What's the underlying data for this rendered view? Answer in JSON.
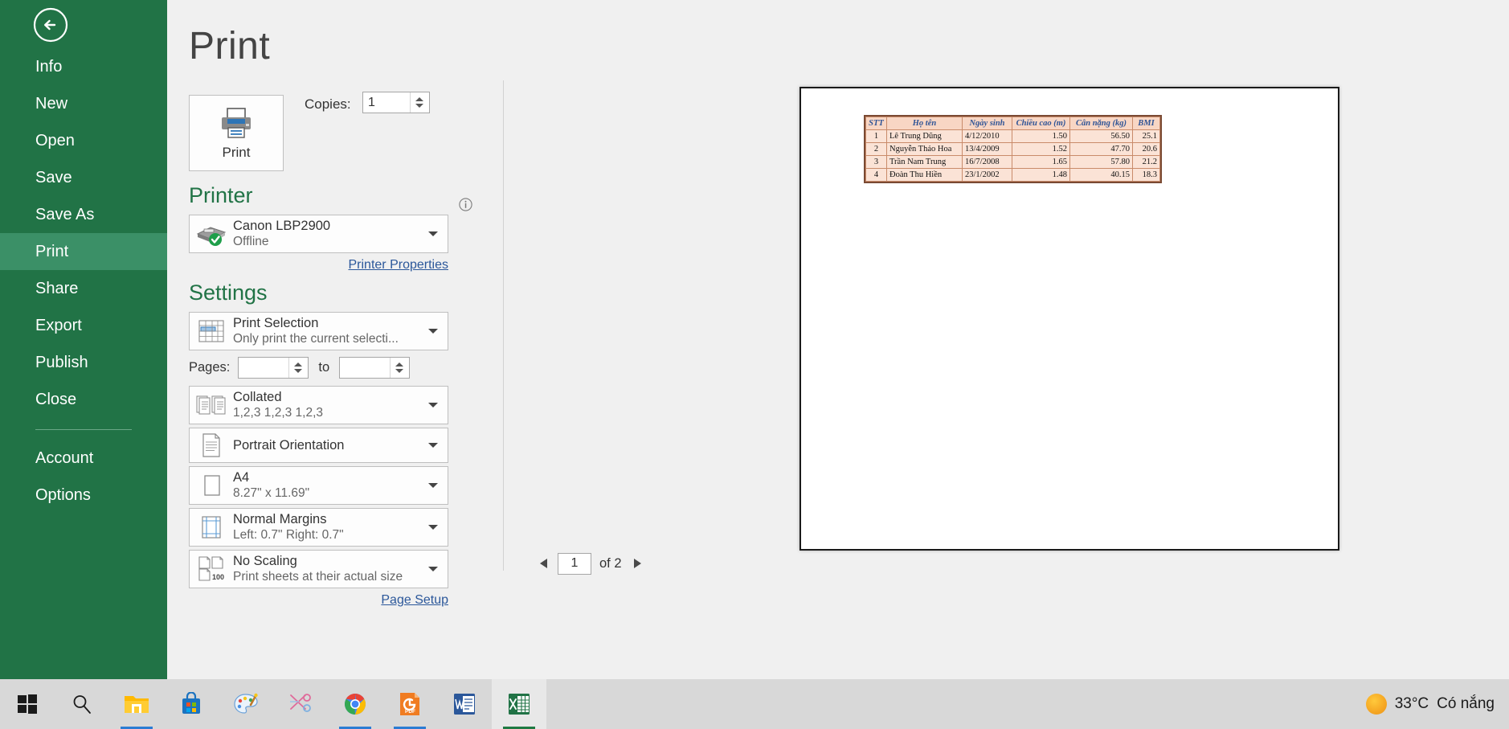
{
  "window": {
    "app": "Excel",
    "back_button": "back-arrow"
  },
  "sidebar": {
    "items": [
      {
        "label": "Info",
        "active": false
      },
      {
        "label": "New",
        "active": false
      },
      {
        "label": "Open",
        "active": false
      },
      {
        "label": "Save",
        "active": false
      },
      {
        "label": "Save As",
        "active": false
      },
      {
        "label": "Print",
        "active": true
      },
      {
        "label": "Share",
        "active": false
      },
      {
        "label": "Export",
        "active": false
      },
      {
        "label": "Publish",
        "active": false
      },
      {
        "label": "Close",
        "active": false
      }
    ],
    "footer_items": [
      {
        "label": "Account"
      },
      {
        "label": "Options"
      }
    ],
    "accent_color": "#217346",
    "active_color": "#3b9067"
  },
  "main": {
    "title": "Print",
    "print_button_label": "Print",
    "copies_label": "Copies:",
    "copies_value": "1",
    "printer_section_title": "Printer",
    "printer": {
      "name": "Canon LBP2900",
      "status": "Offline"
    },
    "printer_properties_link": "Printer Properties",
    "settings_section_title": "Settings",
    "settings": [
      {
        "icon": "print-selection-icon",
        "title": "Print Selection",
        "subtitle": "Only print the current selecti..."
      },
      {
        "icon": "collated-icon",
        "title": "Collated",
        "subtitle": "1,2,3   1,2,3   1,2,3"
      },
      {
        "icon": "portrait-icon",
        "title": "Portrait Orientation",
        "subtitle": ""
      },
      {
        "icon": "paper-size-icon",
        "title": "A4",
        "subtitle": "8.27\" x 11.69\""
      },
      {
        "icon": "margins-icon",
        "title": "Normal Margins",
        "subtitle": "Left:  0.7\"    Right:  0.7\""
      },
      {
        "icon": "scaling-icon",
        "title": "No Scaling",
        "subtitle": "Print sheets at their actual size"
      }
    ],
    "pages": {
      "label": "Pages:",
      "from_value": "",
      "to_label": "to",
      "to_value": ""
    },
    "page_setup_link": "Page Setup"
  },
  "pager": {
    "current_page": "1",
    "of_label": "of 2",
    "prev_icon": "triangle-left-icon",
    "next_icon": "triangle-right-icon"
  },
  "preview": {
    "table": {
      "headers": [
        "STT",
        "Họ tên",
        "Ngày sinh",
        "Chiều cao (m)",
        "Cân nặng (kg)",
        "BMI"
      ],
      "rows": [
        [
          "1",
          "Lê Trung Dũng",
          "4/12/2010",
          "1.50",
          "56.50",
          "25.1"
        ],
        [
          "2",
          "Nguyễn Thảo Hoa",
          "13/4/2009",
          "1.52",
          "47.70",
          "20.6"
        ],
        [
          "3",
          "Trần Nam Trung",
          "16/7/2008",
          "1.65",
          "57.80",
          "21.2"
        ],
        [
          "4",
          "Đoàn Thu Hiền",
          "23/1/2002",
          "1.48",
          "40.15",
          "18.3"
        ]
      ],
      "header_text_color": "#2f5496",
      "fill_color": "#fbe3d6",
      "border_color": "#c98b6a"
    }
  },
  "taskbar": {
    "items": [
      {
        "name": "start-button",
        "label": "Start"
      },
      {
        "name": "search-button",
        "label": "Search"
      },
      {
        "name": "file-explorer",
        "label": "File Explorer"
      },
      {
        "name": "microsoft-store",
        "label": "Microsoft Store"
      },
      {
        "name": "paint",
        "label": "Paint"
      },
      {
        "name": "snipping-tool",
        "label": "Snipping Tool"
      },
      {
        "name": "google-chrome",
        "label": "Google Chrome"
      },
      {
        "name": "pdf-app",
        "label": "PDF"
      },
      {
        "name": "microsoft-word",
        "label": "Word"
      },
      {
        "name": "microsoft-excel",
        "label": "Excel"
      }
    ],
    "weather": {
      "temperature": "33°C",
      "description": "Có nắng",
      "icon": "sun-icon"
    }
  }
}
